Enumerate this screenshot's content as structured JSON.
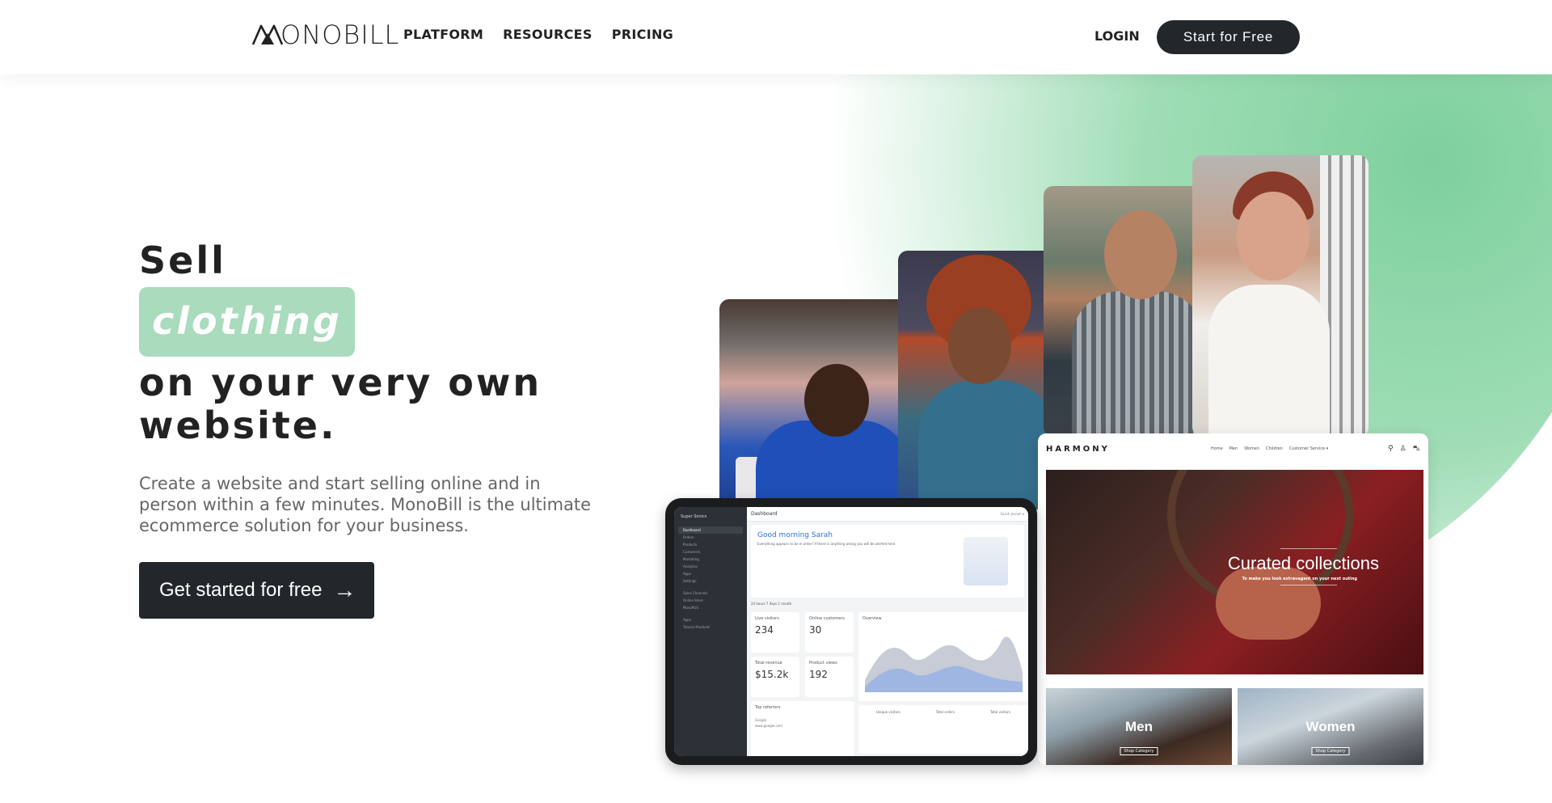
{
  "header": {
    "logo_text": "ONOBILL",
    "nav": [
      "PLATFORM",
      "RESOURCES",
      "PRICING"
    ],
    "login": "LOGIN",
    "cta": "Start for Free"
  },
  "hero": {
    "line1": "Sell",
    "highlight": "clothing",
    "line2": "on your very own",
    "line3": "website.",
    "subtitle": "Create a website and start selling online and in person within a few minutes. MonoBill is the ultimate ecommerce solution for your business.",
    "cta": "Get started for free",
    "cta_arrow": "→"
  },
  "storefront": {
    "brand": "HARMONY",
    "menu": [
      "Home",
      "Men",
      "Women",
      "Children",
      "Customer Service ▾"
    ],
    "hero_title": "Curated collections",
    "hero_sub": "To make you look extravagant on your next outing",
    "categories": [
      {
        "label": "Men",
        "button": "Shop Category"
      },
      {
        "label": "Women",
        "button": "Shop Category"
      }
    ]
  },
  "dashboard": {
    "store_name": "Super Sonics",
    "header_title": "Dashboard",
    "user": "Sarah Joseph ▾",
    "greeting": "Good morning Sarah",
    "greeting_sub": "Everything appears to be in order! If there is anything wrong you will be alerted here",
    "sidebar": [
      "Dashboard",
      "Orders",
      "Products",
      "Customers",
      "Marketing",
      "Analytics",
      "Apps",
      "Settings",
      "Sales Channels",
      "Online Store",
      "MonoPOS",
      "Apps",
      "Tutorial Products"
    ],
    "ranges": "24 hours   7 days   1 month",
    "kpis": [
      {
        "label": "Live visitors",
        "value": "234"
      },
      {
        "label": "Online customers",
        "value": "30"
      },
      {
        "label": "Total revenue",
        "value": "$15.2k"
      },
      {
        "label": "Product views",
        "value": "192"
      }
    ],
    "overview_title": "Overview",
    "referrers_title": "Top referrers",
    "referrers": [
      "Google",
      "www.google.com"
    ],
    "bottom_stats": [
      "Unique visitors",
      "Total orders",
      "Total visitors"
    ]
  },
  "colors": {
    "dark": "#23272b",
    "accent_green": "#a9dbbd",
    "arc_green": "#7ed09d"
  }
}
